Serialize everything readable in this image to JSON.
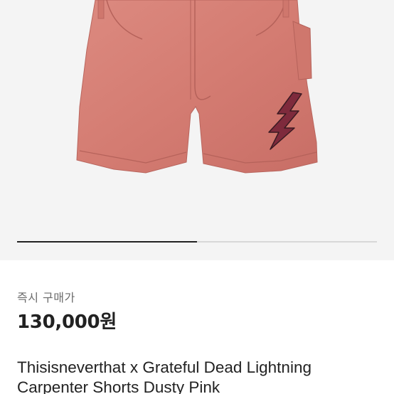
{
  "product": {
    "image_alt": "Pink carpenter shorts with lightning bolt patch",
    "image_index": 1,
    "image_count": 2
  },
  "purchase": {
    "label": "즉시 구매가",
    "price": "130,000원"
  },
  "title": "Thisisneverthat x Grateful Dead Lightning Carpenter Shorts Dusty Pink",
  "colors": {
    "shorts": "#d67f75",
    "bolt": "#7e2a3c",
    "background": "#f4f4f4"
  }
}
